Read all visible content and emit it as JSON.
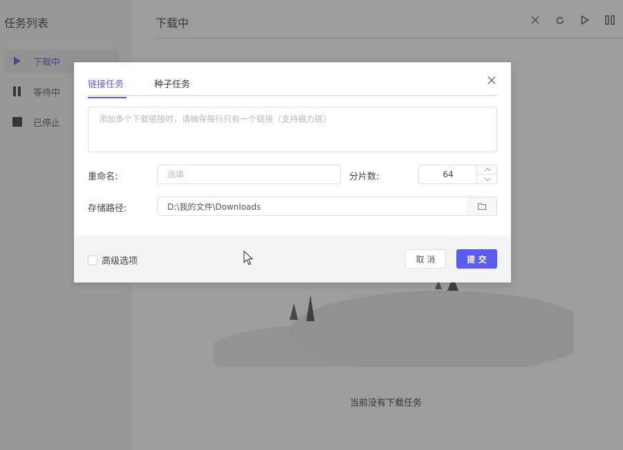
{
  "sidebar": {
    "title": "任务列表",
    "items": [
      {
        "label": "下载中",
        "icon": "play-icon"
      },
      {
        "label": "等待中",
        "icon": "pause-icon"
      },
      {
        "label": "已停止",
        "icon": "stop-icon"
      }
    ]
  },
  "main": {
    "title": "下载中",
    "toolbar": [
      "close-icon",
      "refresh-icon",
      "play-icon",
      "pause-icon"
    ],
    "empty_text": "当前没有下载任务"
  },
  "dialog": {
    "tabs": [
      {
        "label": "链接任务",
        "active": true
      },
      {
        "label": "种子任务",
        "active": false
      }
    ],
    "urls_placeholder": "添加多个下载链接时，请确保每行只有一个链接（支持磁力链）",
    "rename_label": "重命名:",
    "rename_placeholder": "选填",
    "split_label": "分片数:",
    "split_value": "64",
    "path_label": "存储路径:",
    "path_value": "D:\\我的文件\\Downloads",
    "advanced_label": "高级选项",
    "cancel_label": "取 消",
    "submit_label": "提 交"
  },
  "colors": {
    "accent": "#5b5bf0",
    "overlay": "rgba(60,60,60,0.5)"
  }
}
